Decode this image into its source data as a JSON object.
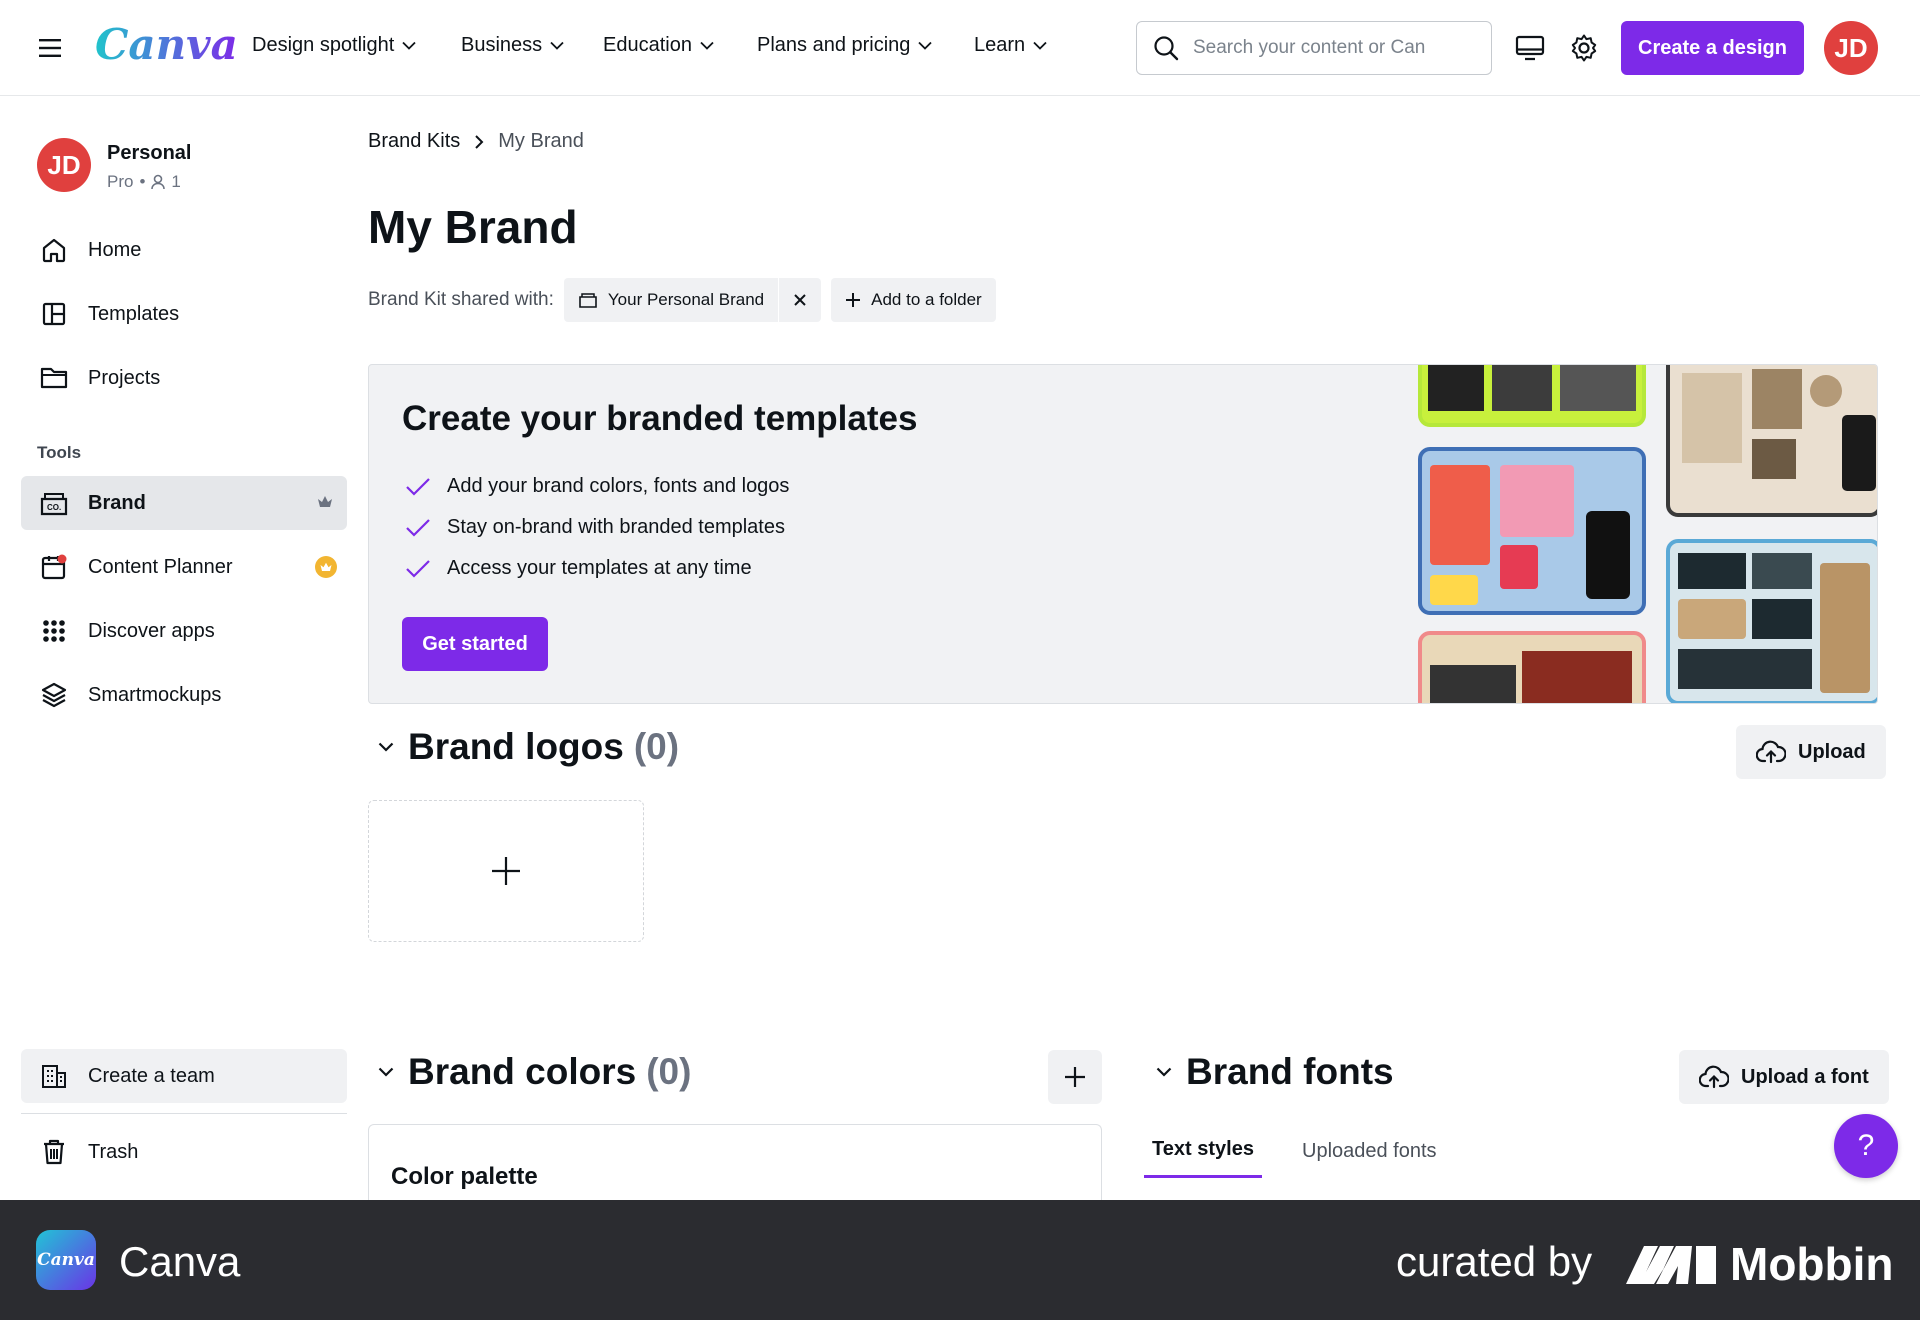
{
  "header": {
    "logo": "Canva",
    "nav": [
      {
        "label": "Design spotlight"
      },
      {
        "label": "Business"
      },
      {
        "label": "Education"
      },
      {
        "label": "Plans and pricing"
      },
      {
        "label": "Learn"
      }
    ],
    "search_placeholder": "Search your content or Can",
    "create_label": "Create a design",
    "avatar_initials": "JD"
  },
  "sidebar": {
    "account_name": "Personal",
    "account_plan": "Pro",
    "account_members": "1",
    "avatar_initials": "JD",
    "items": [
      {
        "label": "Home",
        "icon": "home-icon"
      },
      {
        "label": "Templates",
        "icon": "templates-icon"
      },
      {
        "label": "Projects",
        "icon": "folder-icon"
      }
    ],
    "tools_heading": "Tools",
    "tools": [
      {
        "label": "Brand",
        "icon": "brand-icon",
        "active": true
      },
      {
        "label": "Content Planner",
        "icon": "calendar-icon"
      },
      {
        "label": "Discover apps",
        "icon": "apps-grid-icon"
      },
      {
        "label": "Smartmockups",
        "icon": "layers-icon"
      }
    ],
    "create_team": "Create a team",
    "trash": "Trash"
  },
  "main": {
    "breadcrumb": [
      "Brand Kits",
      "My Brand"
    ],
    "title": "My Brand",
    "shared_label": "Brand Kit shared with:",
    "shared_chip": "Your Personal Brand",
    "add_folder": "Add to a folder",
    "promo": {
      "title": "Create your branded templates",
      "bullets": [
        "Add your brand colors, fonts and logos",
        "Stay on-brand with branded templates",
        "Access your templates at any time"
      ],
      "cta": "Get started"
    },
    "logos": {
      "title": "Brand logos",
      "count": "(0)",
      "upload": "Upload"
    },
    "colors": {
      "title": "Brand colors",
      "count": "(0)",
      "palette": "Color palette"
    },
    "fonts": {
      "title": "Brand fonts",
      "upload": "Upload a font",
      "tabs": [
        "Text styles",
        "Uploaded fonts"
      ]
    },
    "help": "?"
  },
  "footer": {
    "app_name": "Canva",
    "curated": "curated by",
    "brand": "Mobbin"
  },
  "colors": {
    "accent": "#7d2ae8",
    "avatar": "#e0403e",
    "footer_bg": "#2b2c30"
  }
}
